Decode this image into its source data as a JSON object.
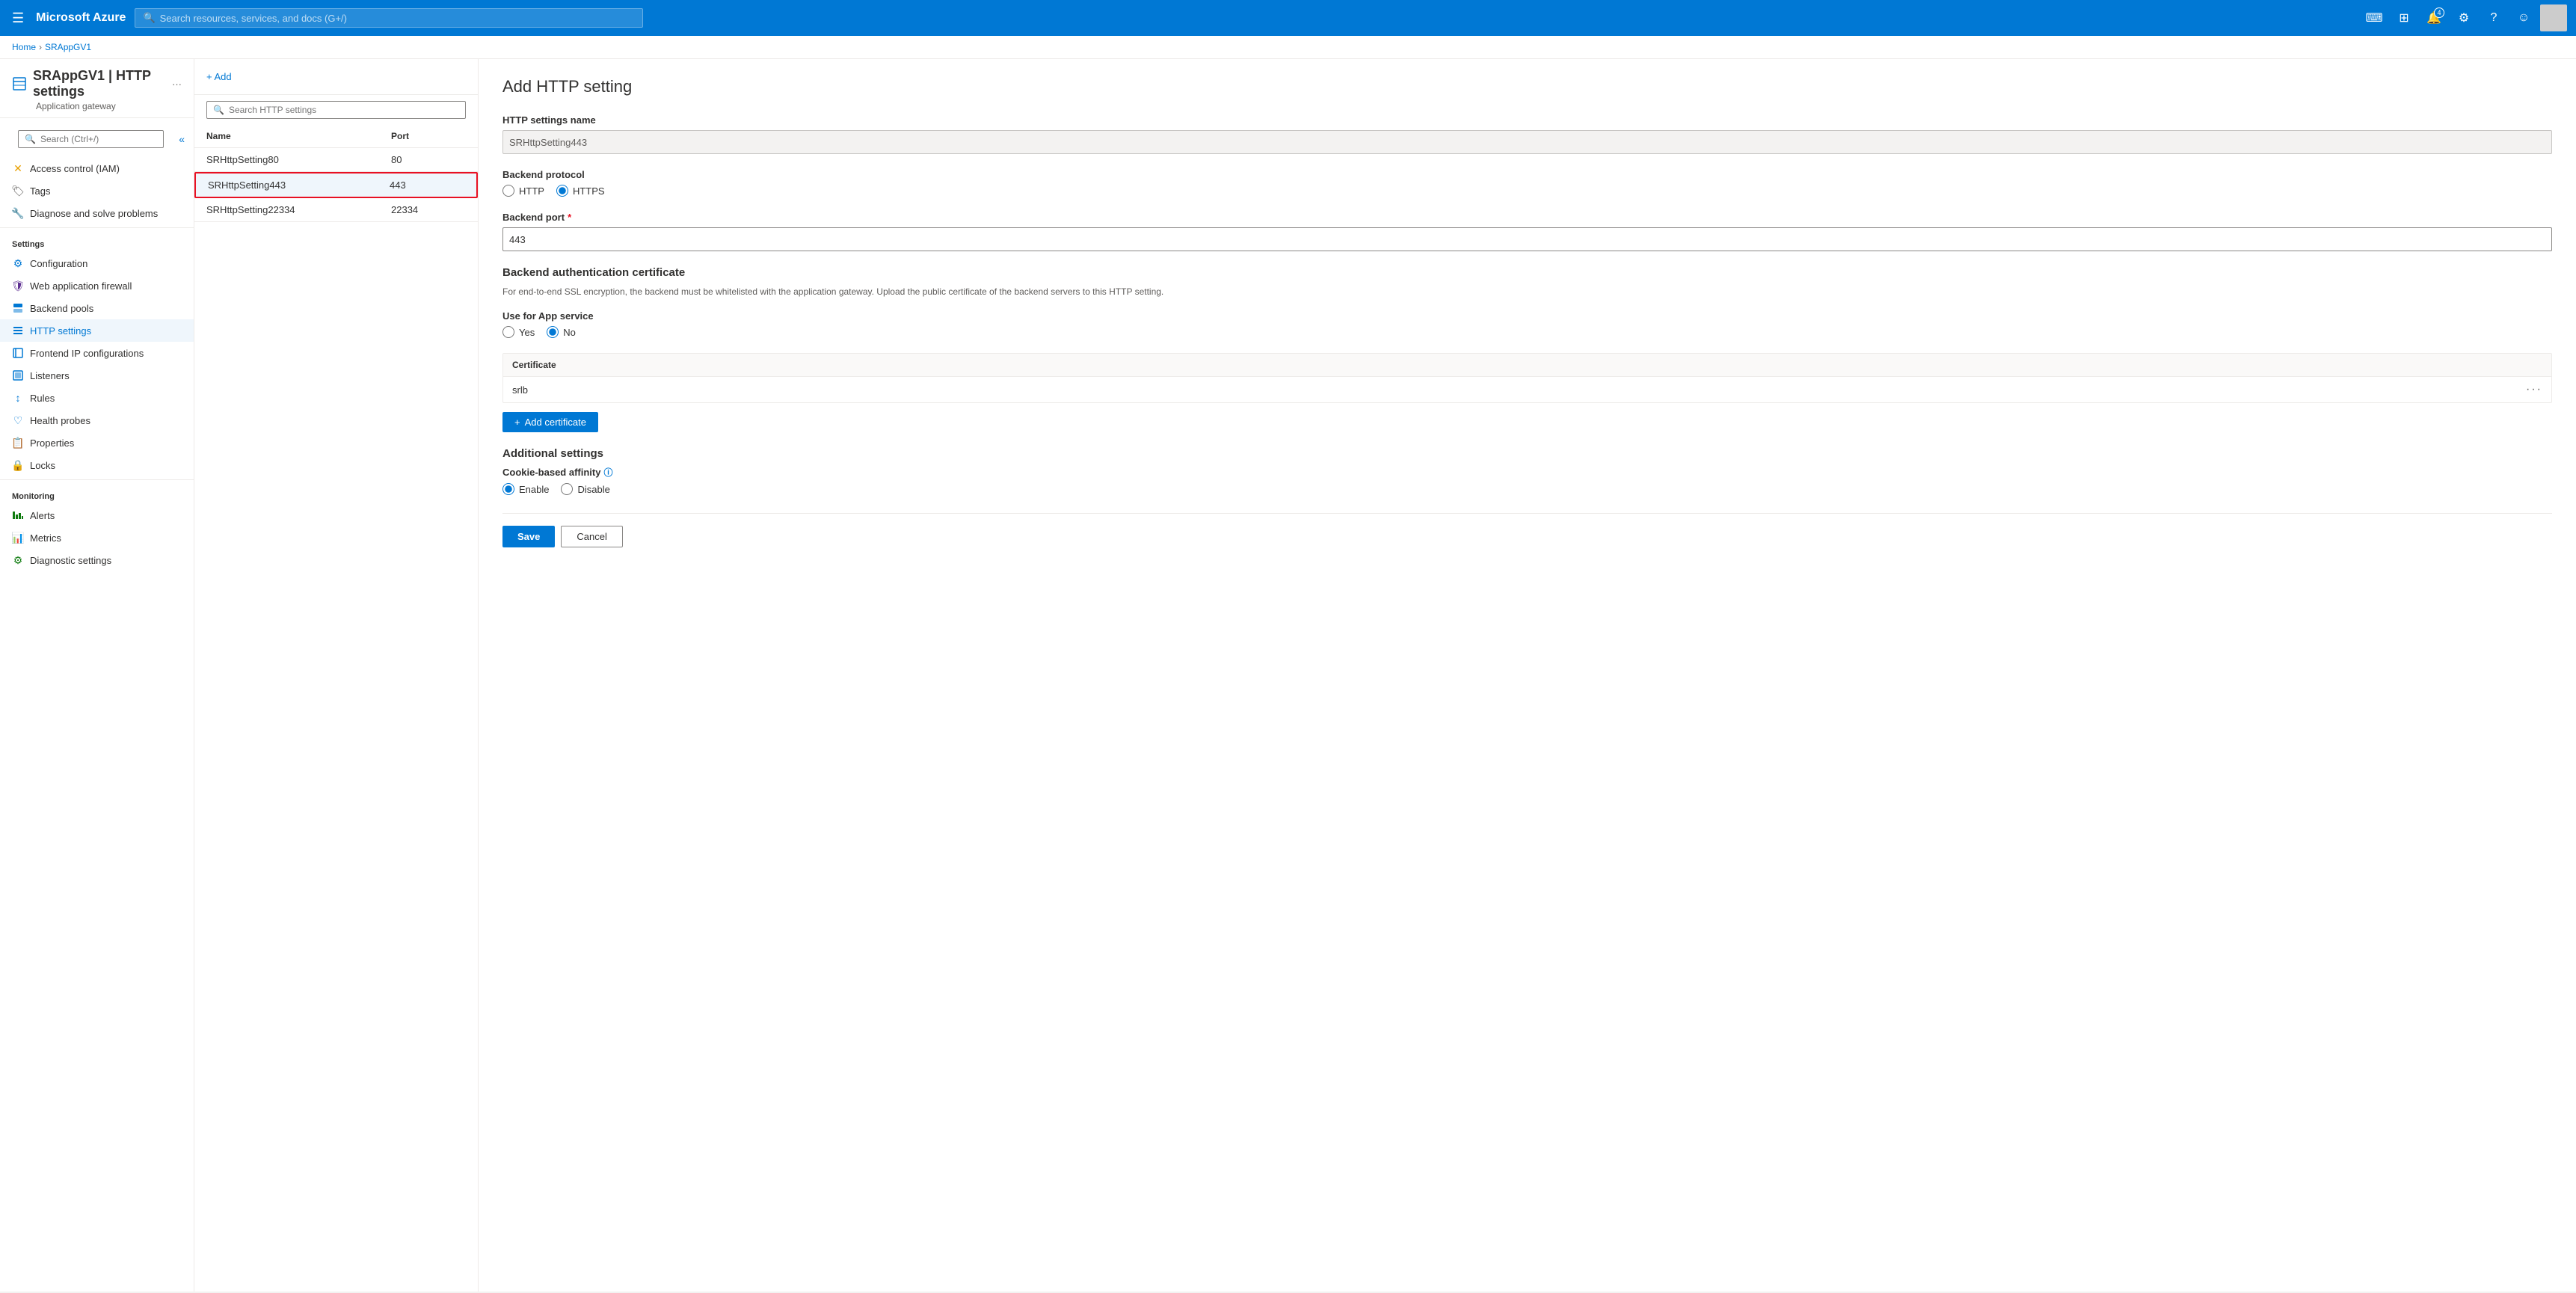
{
  "topnav": {
    "hamburger_icon": "☰",
    "brand": "Microsoft Azure",
    "search_placeholder": "Search resources, services, and docs (G+/)",
    "icons": [
      {
        "name": "cloud-shell-icon",
        "symbol": "⌨",
        "badge": null
      },
      {
        "name": "portal-settings-icon",
        "symbol": "⊞",
        "badge": null
      },
      {
        "name": "notifications-icon",
        "symbol": "🔔",
        "badge": "4"
      },
      {
        "name": "settings-icon",
        "symbol": "⚙",
        "badge": null
      },
      {
        "name": "help-icon",
        "symbol": "?",
        "badge": null
      },
      {
        "name": "feedback-icon",
        "symbol": "☺",
        "badge": null
      }
    ]
  },
  "breadcrumb": {
    "home": "Home",
    "resource": "SRAppGV1"
  },
  "sidebar": {
    "title": "SRAppGV1",
    "pipe": "|",
    "subtitle": "HTTP settings",
    "resource_type": "Application gateway",
    "search_placeholder": "Search (Ctrl+/)",
    "collapse_icon": "«",
    "more_icon": "···",
    "nav_items": [
      {
        "id": "access-control",
        "label": "Access control (IAM)",
        "icon": "👤",
        "section": null
      },
      {
        "id": "tags",
        "label": "Tags",
        "icon": "🏷",
        "section": null
      },
      {
        "id": "diagnose",
        "label": "Diagnose and solve problems",
        "icon": "🔧",
        "section": null
      },
      {
        "id": "settings-header",
        "label": "Settings",
        "type": "header"
      },
      {
        "id": "configuration",
        "label": "Configuration",
        "icon": "⚙"
      },
      {
        "id": "web-app-firewall",
        "label": "Web application firewall",
        "icon": "🛡"
      },
      {
        "id": "backend-pools",
        "label": "Backend pools",
        "icon": "🔷"
      },
      {
        "id": "http-settings",
        "label": "HTTP settings",
        "icon": "≡",
        "active": true
      },
      {
        "id": "frontend-ip",
        "label": "Frontend IP configurations",
        "icon": "⊟"
      },
      {
        "id": "listeners",
        "label": "Listeners",
        "icon": "⊞"
      },
      {
        "id": "rules",
        "label": "Rules",
        "icon": "↕"
      },
      {
        "id": "health-probes",
        "label": "Health probes",
        "icon": "♡"
      },
      {
        "id": "properties",
        "label": "Properties",
        "icon": "📋"
      },
      {
        "id": "locks",
        "label": "Locks",
        "icon": "🔒"
      },
      {
        "id": "monitoring-header",
        "label": "Monitoring",
        "type": "header"
      },
      {
        "id": "alerts",
        "label": "Alerts",
        "icon": "▮▮"
      },
      {
        "id": "metrics",
        "label": "Metrics",
        "icon": "📊"
      },
      {
        "id": "diagnostic-settings",
        "label": "Diagnostic settings",
        "icon": "⚙"
      }
    ]
  },
  "list_panel": {
    "add_button_label": "+ Add",
    "search_placeholder": "Search HTTP settings",
    "columns": [
      "Name",
      "Port"
    ],
    "rows": [
      {
        "name": "SRHttpSetting80",
        "port": "80",
        "selected": false
      },
      {
        "name": "SRHttpSetting443",
        "port": "443",
        "selected": true
      },
      {
        "name": "SRHttpSetting22334",
        "port": "22334",
        "selected": false
      }
    ]
  },
  "form": {
    "title": "Add HTTP setting",
    "http_settings_name_label": "HTTP settings name",
    "http_settings_name_value": "SRHttpSetting443",
    "backend_protocol_label": "Backend protocol",
    "protocol_options": [
      {
        "label": "HTTP",
        "value": "http",
        "selected": false
      },
      {
        "label": "HTTPS",
        "value": "https",
        "selected": true
      }
    ],
    "backend_port_label": "Backend port",
    "backend_port_required": "*",
    "backend_port_value": "443",
    "backend_auth_cert_title": "Backend authentication certificate",
    "backend_auth_cert_desc": "For end-to-end SSL encryption, the backend must be whitelisted with the application gateway. Upload the public certificate of the backend servers to this HTTP setting.",
    "use_for_app_service_label": "Use for App service",
    "app_service_options": [
      {
        "label": "Yes",
        "value": "yes",
        "selected": false
      },
      {
        "label": "No",
        "value": "no",
        "selected": true
      }
    ],
    "certificate_section_label": "Certificate",
    "certificate_name": "srlb",
    "certificate_more_icon": "···",
    "add_certificate_button": "+ Add certificate",
    "additional_settings_title": "Additional settings",
    "cookie_affinity_label": "Cookie-based affinity",
    "cookie_affinity_info_icon": "ⓘ",
    "cookie_affinity_options": [
      {
        "label": "Enable",
        "value": "enable",
        "selected": true
      },
      {
        "label": "Disable",
        "value": "disable",
        "selected": false
      }
    ],
    "save_button": "Save",
    "cancel_button": "Cancel"
  }
}
